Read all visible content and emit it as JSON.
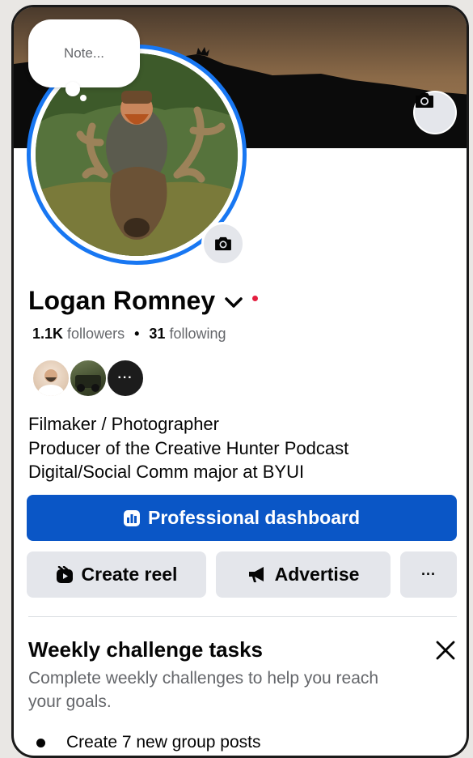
{
  "note": {
    "placeholder": "Note..."
  },
  "profile": {
    "name": "Logan Romney",
    "followers_count": "1.1K",
    "followers_label": "followers",
    "separator": "•",
    "following_count": "31",
    "following_label": "following",
    "mutual_more": "···",
    "bio_lines": [
      "Filmaker / Photographer",
      "Producer of the Creative Hunter Podcast",
      "Digital/Social Comm major at BYUI"
    ]
  },
  "actions": {
    "professional_dashboard": "Professional dashboard",
    "create_reel": "Create reel",
    "advertise": "Advertise",
    "more": "···"
  },
  "weekly_challenge": {
    "title": "Weekly challenge tasks",
    "description": "Complete weekly challenges to help you reach your goals.",
    "tasks": [
      "Create 7 new group posts"
    ]
  },
  "colors": {
    "accent": "#1877f2",
    "primary_button": "#0a56c6",
    "secondary_button": "#e4e6eb",
    "status_dot": "#e41e3f"
  },
  "icons": [
    "camera-icon",
    "chevron-down-icon",
    "dashboard-icon",
    "reel-icon",
    "megaphone-icon",
    "close-icon"
  ]
}
